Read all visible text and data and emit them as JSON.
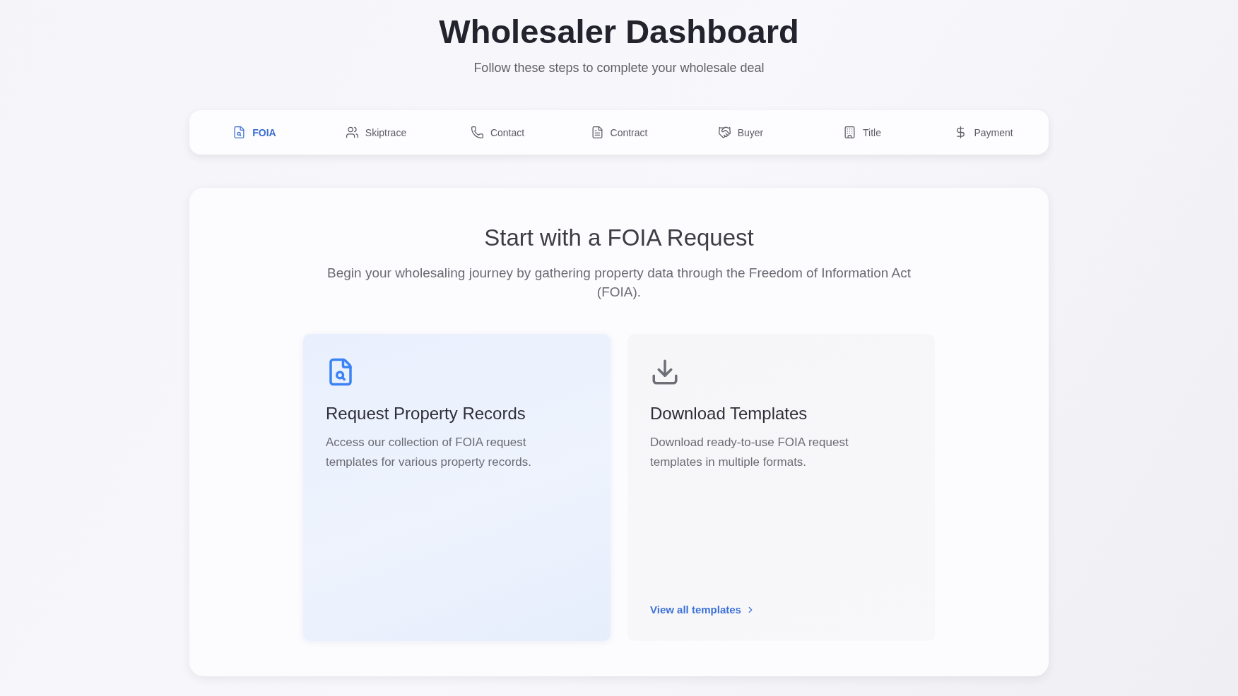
{
  "header": {
    "title": "Wholesaler Dashboard",
    "subtitle": "Follow these steps to complete your wholesale deal"
  },
  "tabs": [
    {
      "label": "FOIA",
      "selected": true
    },
    {
      "label": "Skiptrace",
      "selected": false
    },
    {
      "label": "Contact",
      "selected": false
    },
    {
      "label": "Contract",
      "selected": false
    },
    {
      "label": "Buyer",
      "selected": false
    },
    {
      "label": "Title",
      "selected": false
    },
    {
      "label": "Payment",
      "selected": false
    }
  ],
  "panel": {
    "title": "Start with a FOIA Request",
    "description": "Begin your wholesaling journey by gathering property data through the Freedom of Information Act (FOIA).",
    "options": [
      {
        "title": "Request Property Records",
        "description": "Access our collection of FOIA request templates for various property records.",
        "selected": true
      },
      {
        "title": "Download Templates",
        "description": "Download ready-to-use FOIA request templates in multiple formats.",
        "selected": false,
        "link": "View all templates"
      }
    ]
  }
}
